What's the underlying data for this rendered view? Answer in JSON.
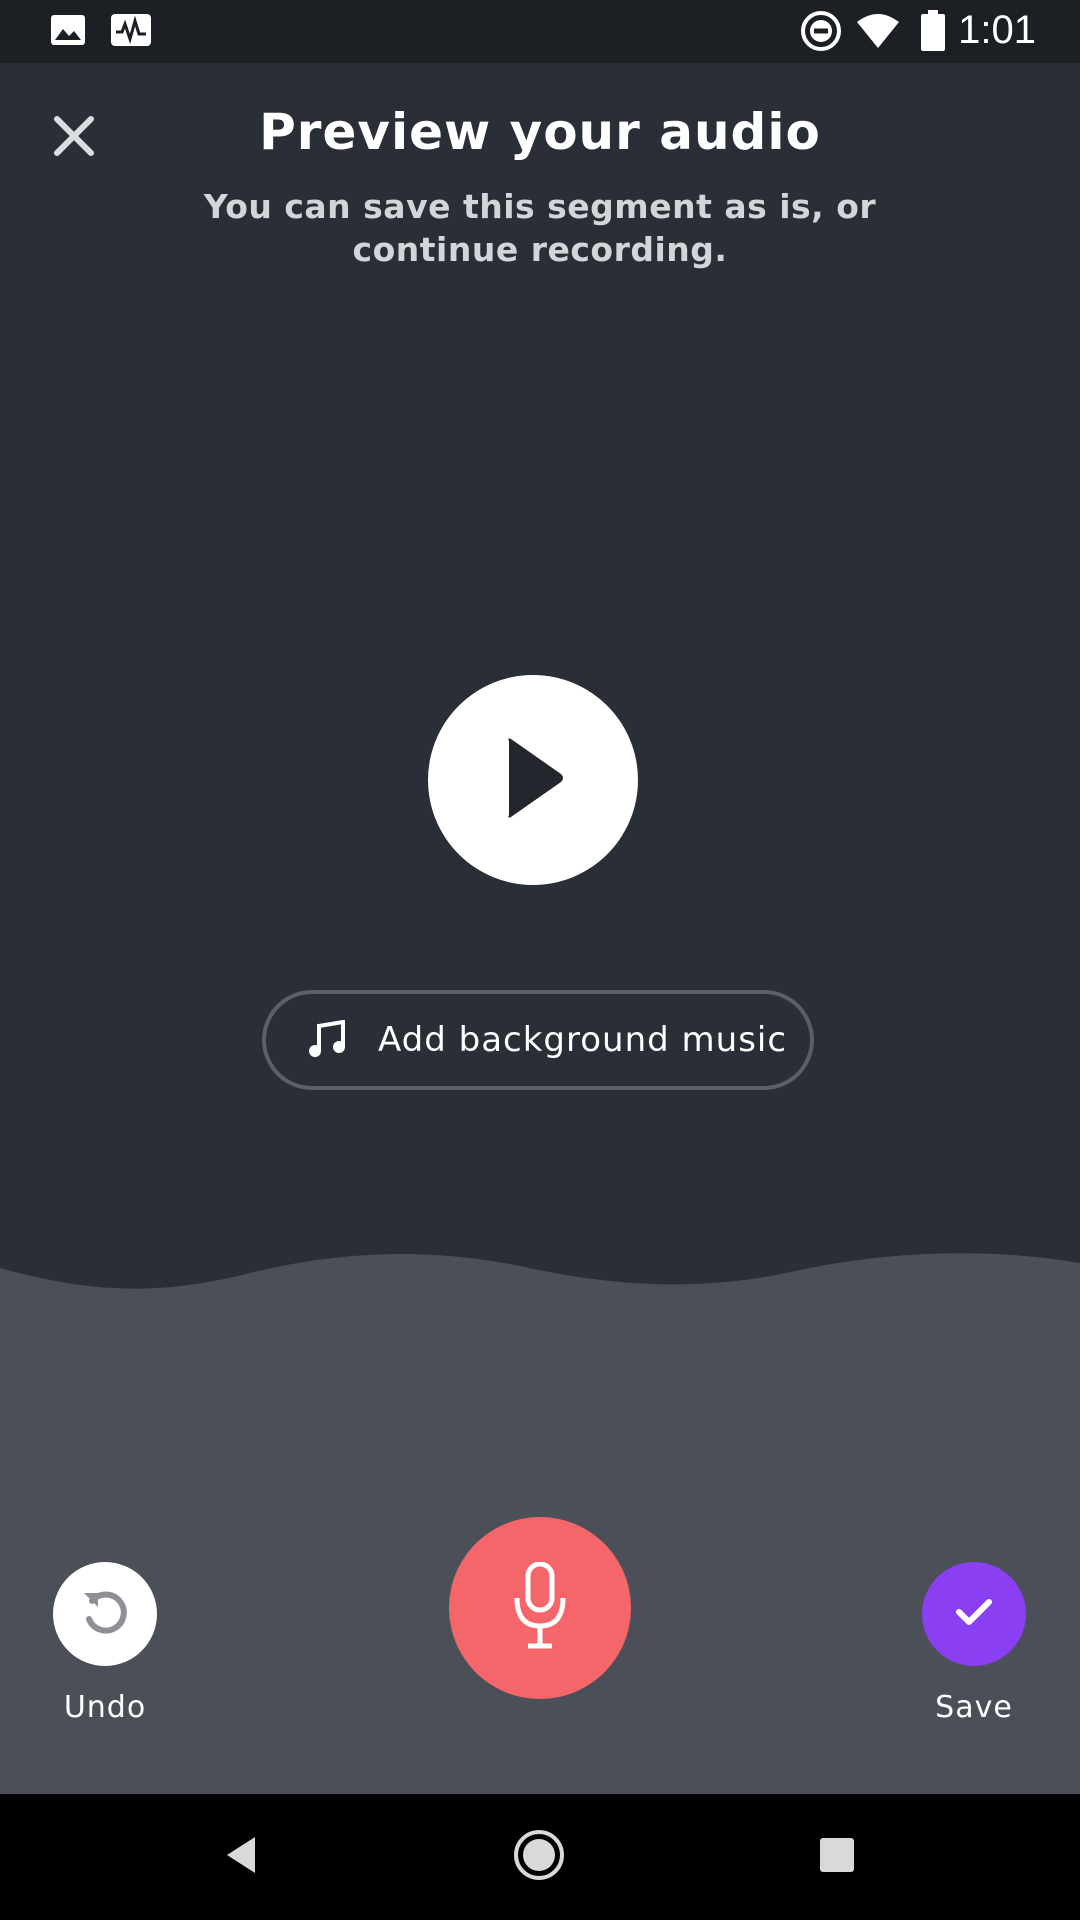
{
  "status_bar": {
    "time": "1:01",
    "left_icons": [
      "image-icon",
      "activity-monitor-icon"
    ],
    "right_icons": [
      "do-not-disturb-icon",
      "wifi-icon",
      "battery-icon"
    ]
  },
  "header": {
    "close_icon": "close-icon",
    "title": "Preview your audio",
    "subtitle": "You can save this segment as is, or continue recording."
  },
  "player": {
    "play_icon": "play-icon"
  },
  "music_button": {
    "icon": "music-note-icon",
    "label": "Add background music"
  },
  "controls": {
    "undo": {
      "icon": "undo-icon",
      "label": "Undo"
    },
    "record": {
      "icon": "microphone-icon"
    },
    "save": {
      "icon": "checkmark-icon",
      "label": "Save"
    }
  },
  "nav_bar": {
    "buttons": [
      "back-icon",
      "home-icon",
      "recents-icon"
    ]
  },
  "colors": {
    "background": "#2a2e36",
    "panel": "#4b4f57",
    "record": "#f4666a",
    "save": "#8a3ff2",
    "status_bar": "#1c1f24"
  }
}
